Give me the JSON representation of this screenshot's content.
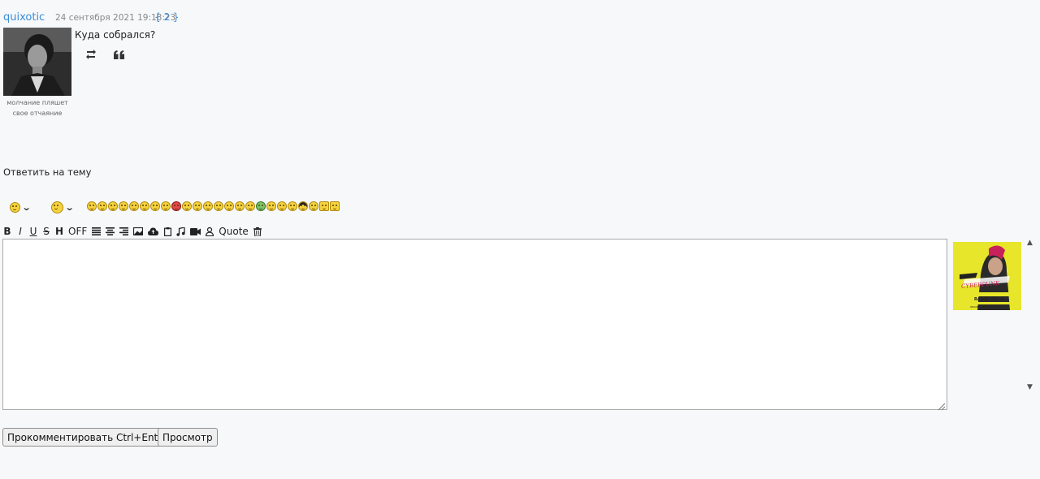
{
  "post": {
    "username": "quixotic",
    "date": "24 сентября 2021 19:18:23",
    "count": "{ 2 }",
    "status_line1": "молчание пляшет",
    "status_line2": "свое отчаяние",
    "text": "Куда собрался?",
    "actions": {
      "repost_icon": "repost-icon",
      "quote_icon": "quote-icon"
    }
  },
  "reply": {
    "title": "Ответить на тему",
    "smileys_count_label": "",
    "toolbar": {
      "bold": "B",
      "italic": "I",
      "underline": "U",
      "strike": "S",
      "heading": "H",
      "off": "OFF",
      "quote": "Quote"
    },
    "textarea_value": "",
    "album_art": {
      "line1": "CYBERPUNK",
      "line2": "RADIO VOL.4",
      "line3": "ORIGINAL SOUNDTRACK"
    }
  },
  "buttons": {
    "submit": "Прокомментировать Ctrl+Enter",
    "preview": "Просмотр"
  },
  "colors": {
    "link": "#3a8ed6",
    "background": "#f7f8fa",
    "album": "#e7e62a"
  }
}
